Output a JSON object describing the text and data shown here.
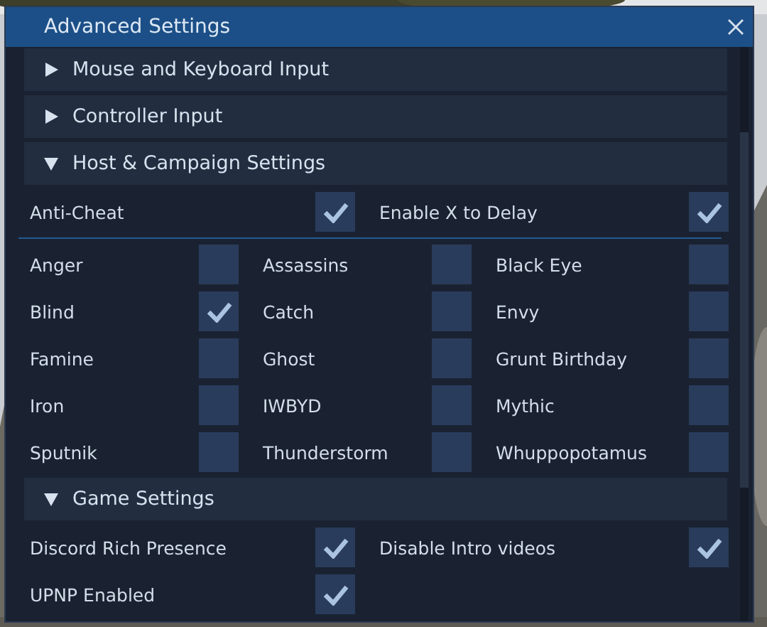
{
  "window": {
    "title": "Advanced Settings"
  },
  "sections": [
    {
      "title": "Mouse and Keyboard Input",
      "expanded": false
    },
    {
      "title": "Controller Input",
      "expanded": false
    },
    {
      "title": "Host & Campaign Settings",
      "expanded": true,
      "groups": [
        {
          "kind": "two-column",
          "items": [
            {
              "label": "Anti-Cheat",
              "checked": true
            },
            {
              "label": "Enable X to Delay",
              "checked": true
            }
          ]
        },
        {
          "kind": "three-column",
          "items": [
            {
              "label": "Anger",
              "checked": false
            },
            {
              "label": "Assassins",
              "checked": false
            },
            {
              "label": "Black Eye",
              "checked": false
            },
            {
              "label": "Blind",
              "checked": true
            },
            {
              "label": "Catch",
              "checked": false
            },
            {
              "label": "Envy",
              "checked": false
            },
            {
              "label": "Famine",
              "checked": false
            },
            {
              "label": "Ghost",
              "checked": false
            },
            {
              "label": "Grunt Birthday",
              "checked": false
            },
            {
              "label": "Iron",
              "checked": false
            },
            {
              "label": "IWBYD",
              "checked": false
            },
            {
              "label": "Mythic",
              "checked": false
            },
            {
              "label": "Sputnik",
              "checked": false
            },
            {
              "label": "Thunderstorm",
              "checked": false
            },
            {
              "label": "Whuppopotamus",
              "checked": false
            }
          ]
        }
      ]
    },
    {
      "title": "Game Settings",
      "expanded": true,
      "groups": [
        {
          "kind": "two-column",
          "items": [
            {
              "label": "Discord Rich Presence",
              "checked": true
            },
            {
              "label": "Disable Intro videos",
              "checked": true
            },
            {
              "label": "UPNP Enabled",
              "checked": true
            }
          ]
        }
      ]
    }
  ]
}
